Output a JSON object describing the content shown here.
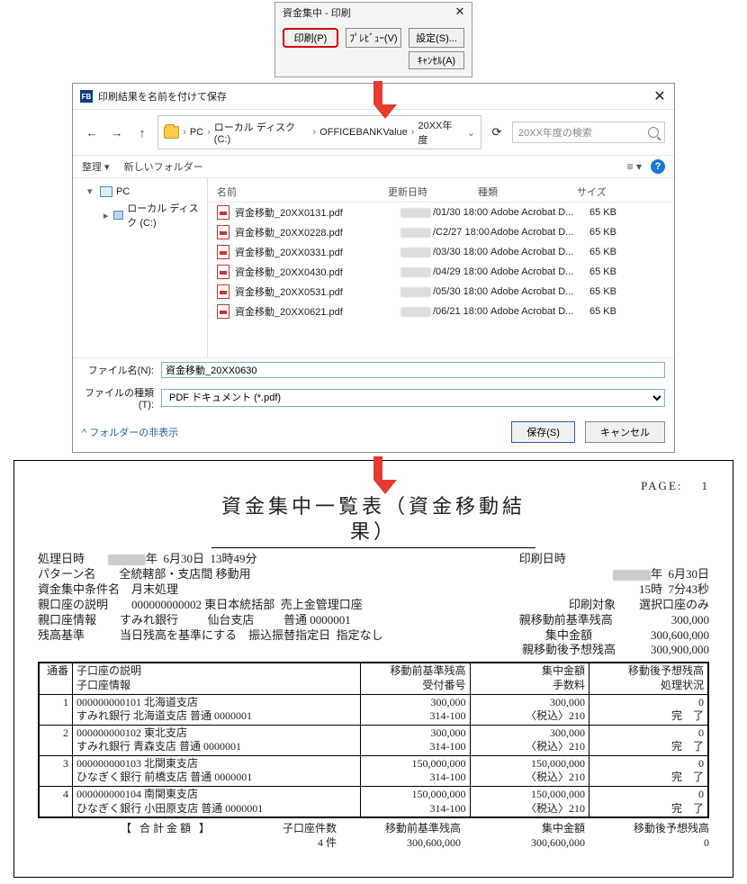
{
  "print_dialog": {
    "title": "資金集中 - 印刷",
    "btn_print": "印刷(P)",
    "btn_preview": "ﾌﾟﾚﾋﾞｭｰ(V)",
    "btn_settings": "設定(S)...",
    "btn_cancel": "ｷｬﾝｾﾙ(A)"
  },
  "save_dialog": {
    "title": "印刷結果を名前を付けて保存",
    "breadcrumb": [
      "PC",
      "ローカル ディスク (C:)",
      "OFFICEBANKValue",
      "20XX年度"
    ],
    "search_placeholder": "20XX年度の検索",
    "organize": "整理 ▾",
    "new_folder": "新しいフォルダー",
    "cols": {
      "name": "名前",
      "date": "更新日時",
      "type": "種類",
      "size": "サイズ"
    },
    "tree": {
      "pc": "PC",
      "drive": "ローカル ディスク (C:)"
    },
    "files": [
      {
        "name": "資金移動_20XX0131.pdf",
        "date": "/01/30 18:00",
        "type": "Adobe Acrobat D...",
        "size": "65 KB"
      },
      {
        "name": "資金移動_20XX0228.pdf",
        "date": "/C2/27 18:00",
        "type": "Adobe Acrobat D...",
        "size": "65 KB"
      },
      {
        "name": "資金移動_20XX0331.pdf",
        "date": "/03/30 18:00",
        "type": "Adobe Acrobat D...",
        "size": "65 KB"
      },
      {
        "name": "資金移動_20XX0430.pdf",
        "date": "/04/29 18:00",
        "type": "Adobe Acrobat D...",
        "size": "65 KB"
      },
      {
        "name": "資金移動_20XX0531.pdf",
        "date": "/05/30 18:00",
        "type": "Adobe Acrobat D...",
        "size": "65 KB"
      },
      {
        "name": "資金移動_20XX0621.pdf",
        "date": "/06/21 18:00",
        "type": "Adobe Acrobat D...",
        "size": "65 KB"
      }
    ],
    "filename_label": "ファイル名(N):",
    "filename_value": "資金移動_20XX0630",
    "filetype_label": "ファイルの種類(T):",
    "filetype_value": "PDF ドキュメント (*.pdf)",
    "hide_folders": "^ フォルダーの非表示",
    "btn_save": "保存(S)",
    "btn_cancel": "キャンセル"
  },
  "report": {
    "page_label": "PAGE:",
    "page_no": "1",
    "title": "資金集中一覧表（資金移動結果）",
    "print_dt_label": "印刷日時",
    "print_dt_line1": "年  6月30日",
    "print_dt_line2": "15時  7分43秒",
    "proc_dt_label": "処理日時",
    "proc_dt_value": "年  6月30日  13時49分",
    "pattern_label": "パターン名",
    "pattern_value": "全統轄部・支店間 移動用",
    "cond_label": "資金集中条件名",
    "cond_value": "月末処理",
    "parent_desc_label": "親口座の説明",
    "parent_desc_value": "000000000002 東日本統括部  売上金管理口座",
    "parent_info_label": "親口座情報",
    "parent_info_value": "すみれ銀行          仙台支店          普通 0000001",
    "balance_base_label": "残高基準",
    "balance_base_value": "当日残高を基準にする    振込振替指定日  指定なし",
    "target_label": "印刷対象",
    "target_value": "選択口座のみ",
    "pb_before_label": "親移動前基準残高",
    "pb_before_value": "300,000",
    "pb_amt_label": "集中金額",
    "pb_amt_value": "300,600,000",
    "pb_after_label": "親移動後予想残高",
    "pb_after_value": "300,900,000",
    "th_no": "通番",
    "th_desc1": "子口座の説明",
    "th_desc2": "子口座情報",
    "th_before1": "移動前基準残高",
    "th_before2": "受付番号",
    "th_amt1": "集中金額",
    "th_amt2": "手数料",
    "th_after1": "移動後予想残高",
    "th_after2": "処理状況",
    "rows": [
      {
        "no": "1",
        "d1": "000000000101 北海道支店",
        "d2": "すみれ銀行      北海道支店      普通 0000001",
        "b1": "300,000",
        "b2": "314-100",
        "a1": "300,000",
        "a2": "〈税込〉210",
        "r1": "0",
        "r2": "完　了"
      },
      {
        "no": "2",
        "d1": "000000000102 東北支店",
        "d2": "すみれ銀行      青森支店        普通 0000001",
        "b1": "300,000",
        "b2": "314-100",
        "a1": "300,000",
        "a2": "〈税込〉210",
        "r1": "0",
        "r2": "完　了"
      },
      {
        "no": "3",
        "d1": "000000000103 北関東支店",
        "d2": "ひなぎく銀行    前橋支店        普通 0000001",
        "b1": "150,000,000",
        "b2": "314-100",
        "a1": "150,000,000",
        "a2": "〈税込〉210",
        "r1": "0",
        "r2": "完　了"
      },
      {
        "no": "4",
        "d1": "000000000104 南関東支店",
        "d2": "ひなぎく銀行    小田原支店      普通 0000001",
        "b1": "150,000,000",
        "b2": "314-100",
        "a1": "150,000,000",
        "a2": "〈税込〉210",
        "r1": "0",
        "r2": "完　了"
      }
    ],
    "total_label": "【 合計金額 】",
    "count_label": "子口座件数",
    "count_value": "4  件",
    "sum_before_label": "移動前基準残高",
    "sum_before_value": "300,600,000",
    "sum_amt_label": "集中金額",
    "sum_amt_value": "300,600,000",
    "sum_after_label": "移動後予想残高",
    "sum_after_value": "0"
  }
}
